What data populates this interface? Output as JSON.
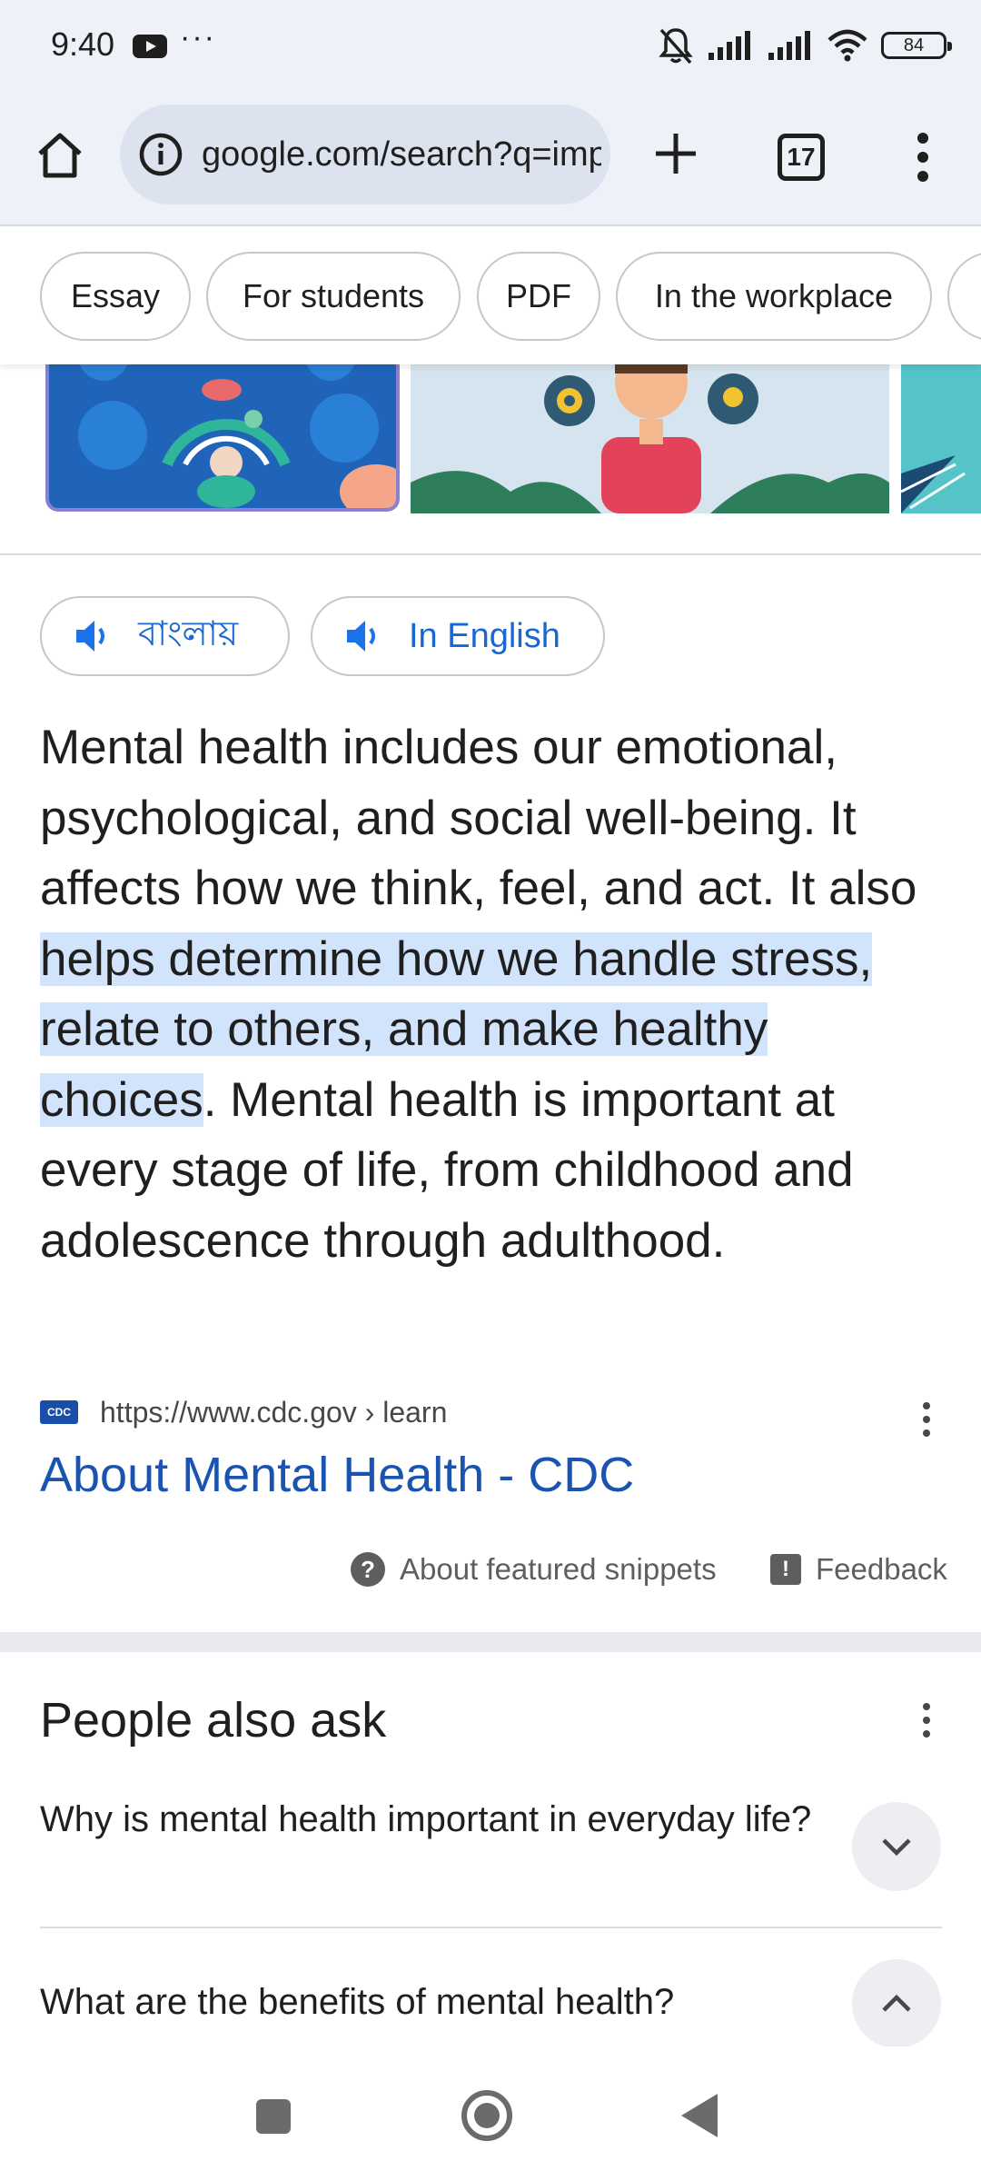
{
  "status_bar": {
    "time": "9:40",
    "more_dots": "···",
    "battery": "84"
  },
  "browser": {
    "url": "google.com/search?q=imp",
    "tab_count": "17"
  },
  "filter_chips": [
    "Essay",
    "For students",
    "PDF",
    "In the workplace"
  ],
  "listen_buttons": {
    "bengali_label": "বাংলায়",
    "english_label": "In English"
  },
  "snippet": {
    "pre": "Mental health includes our emotional, psychological, and social well-being. It affects how we think, feel, and act. It also ",
    "highlight": "helps determine how we handle stress, relate to others, and make healthy choices",
    "post": ". Mental health is important at every stage of life, from childhood and adolescence through adulthood."
  },
  "source": {
    "logo_text": "CDC",
    "url": "https://www.cdc.gov › learn",
    "title": "About Mental Health - CDC"
  },
  "snippet_footer": {
    "about_label": "About featured snippets",
    "feedback_label": "Feedback"
  },
  "people_also_ask": {
    "title": "People also ask",
    "questions": [
      "Why is mental health important in everyday life?",
      "What are the benefits of mental health?"
    ]
  }
}
